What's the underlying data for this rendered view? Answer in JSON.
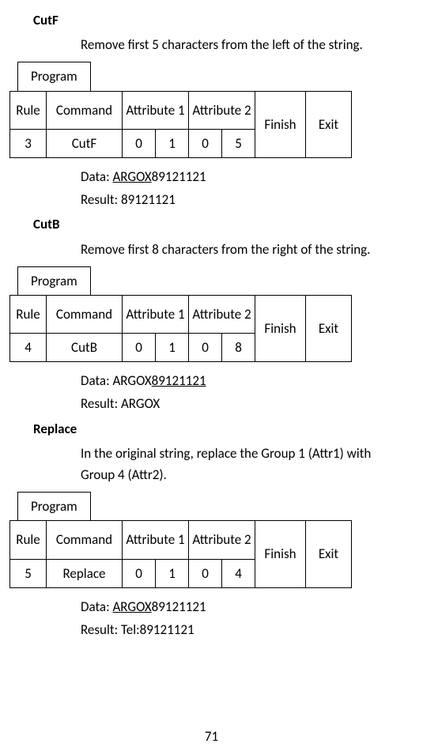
{
  "sections": {
    "cutf": {
      "title": "CutF",
      "desc": "Remove first 5 characters from the left of the string.",
      "data_prefix": "Data: ",
      "data_underlined": "ARGOX",
      "data_suffix": "89121121",
      "result": "Result: 89121121"
    },
    "cutb": {
      "title": "CutB",
      "desc": "Remove first 8 characters from the right of the string.",
      "data_prefix": "Data: ARGOX",
      "data_underlined": "89121121",
      "data_suffix": "",
      "result": "Result: ARGOX"
    },
    "replace": {
      "title": "Replace",
      "desc": "In the original string, replace the Group 1 (Attr1) with Group 4 (Attr2).",
      "data_prefix": "Data: ",
      "data_underlined": "ARGOX",
      "data_suffix": "89121121",
      "result": "Result: Tel:89121121"
    }
  },
  "tables": {
    "program_label": "Program",
    "headers": {
      "rule": "Rule",
      "command": "Command",
      "attr1": "Attribute 1",
      "attr2": "Attribute 2",
      "finish": "Finish",
      "exit": "Exit"
    },
    "table1": {
      "rule": "3",
      "command": "CutF",
      "a1a": "0",
      "a1b": "1",
      "a2a": "0",
      "a2b": "5"
    },
    "table2": {
      "rule": "4",
      "command": "CutB",
      "a1a": "0",
      "a1b": "1",
      "a2a": "0",
      "a2b": "8"
    },
    "table3": {
      "rule": "5",
      "command": "Replace",
      "a1a": "0",
      "a1b": "1",
      "a2a": "0",
      "a2b": "4"
    }
  },
  "page_number": "71"
}
